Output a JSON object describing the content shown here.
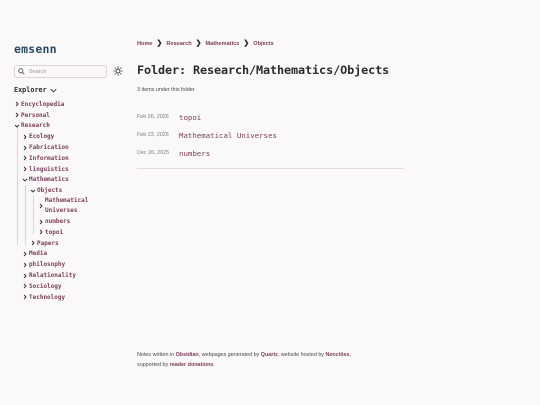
{
  "site": {
    "title": "emsenn"
  },
  "search": {
    "placeholder": "Search"
  },
  "explorer": {
    "heading": "Explorer",
    "items": {
      "encyclopedia": "Encyclopedia",
      "personal": "Personal",
      "research": "Research",
      "ecology": "Ecology",
      "fabrication": "Fabrication",
      "information": "Information",
      "linguistics": "linguistics",
      "mathematics": "Mathematics",
      "objects": "Objects",
      "mathematical_universes": "Mathematical Universes",
      "numbers": "numbers",
      "topoi": "topoi",
      "papers": "Papers",
      "media": "Media",
      "philosophy": "philosophy",
      "relationality": "Relationality",
      "sociology": "Sociology",
      "technology": "Technology"
    }
  },
  "breadcrumb": [
    "Home",
    "Research",
    "Mathematics",
    "Objects"
  ],
  "breadcrumb_separator": "❯",
  "page": {
    "title": "Folder: Research/Mathematics/Objects",
    "count_text": "3 items under this folder."
  },
  "list": [
    {
      "date": "Feb 26, 2026",
      "title": "topoi"
    },
    {
      "date": "Feb 23, 2026",
      "title": "Mathematical Universes"
    },
    {
      "date": "Dec 26, 2025",
      "title": "numbers"
    }
  ],
  "footer": {
    "part1": "Notes written in ",
    "link1": "Obsidian",
    "part2": ", webpages generated by ",
    "link2": "Quartz",
    "part3": ", website hosted by ",
    "link3": "Neocities",
    "part4": ",",
    "part5": "supported by ",
    "link4": "reader donations",
    "part6": "."
  },
  "colors": {
    "accent": "#7a3e5b",
    "title": "#284b63",
    "background": "#faf8f8"
  }
}
